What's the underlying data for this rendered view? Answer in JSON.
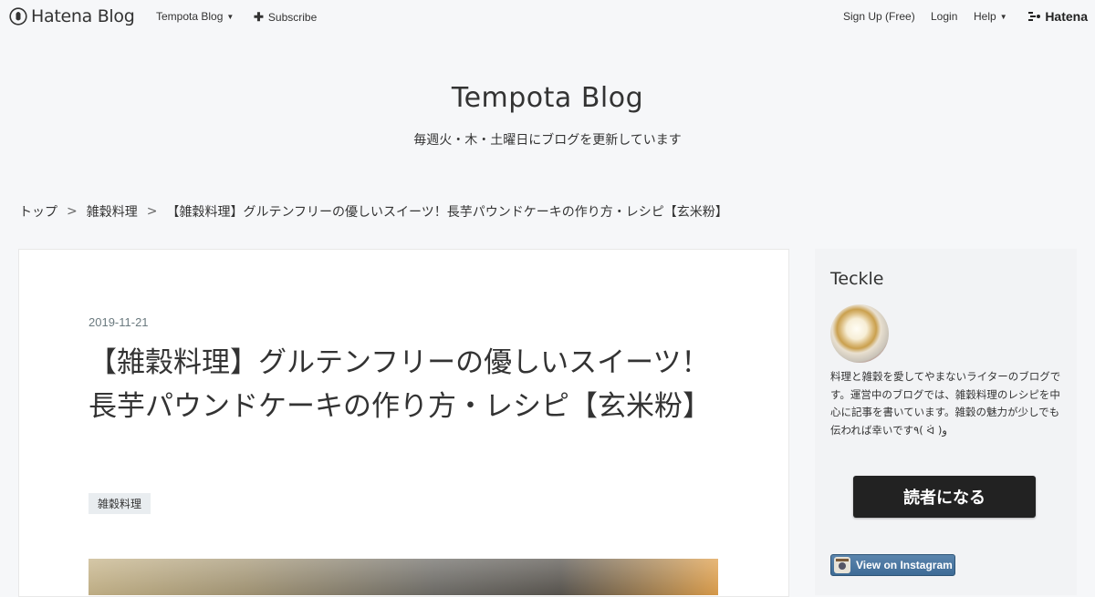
{
  "topbar": {
    "brand": "Hatena Blog",
    "blog_menu": "Tempota Blog",
    "subscribe": "Subscribe",
    "signup": "Sign Up (Free)",
    "login": "Login",
    "help": "Help",
    "hatena": "Hatena"
  },
  "header": {
    "title": "Tempota Blog",
    "description": "毎週火・木・土曜日にブログを更新しています"
  },
  "breadcrumb": {
    "separator": ">",
    "items": [
      "トップ",
      "雑穀料理",
      "【雑穀料理】グルテンフリーの優しいスイーツ！長芋パウンドケーキの作り方・レシピ【玄米粉】"
    ]
  },
  "article": {
    "date": "2019-11-21",
    "title": "【雑穀料理】グルテンフリーの優しいスイーツ！長芋パウンドケーキの作り方・レシピ【玄米粉】",
    "category": "雑穀料理"
  },
  "sidebar": {
    "profile_name": "Teckle",
    "profile_text": "料理と雑穀を愛してやまないライターのブログです。運営中のブログでは、雑穀料理のレシピを中心に記事を書いています。雑穀の魅力が少しでも伝われば幸いです٩( ᐛ )و",
    "follow_label": "読者になる",
    "instagram_label": "View on Instagram"
  },
  "colors": {
    "page_bg": "#f6f7f9",
    "follow_button_bg": "#222222",
    "instagram_bg": "#3e6b96"
  }
}
